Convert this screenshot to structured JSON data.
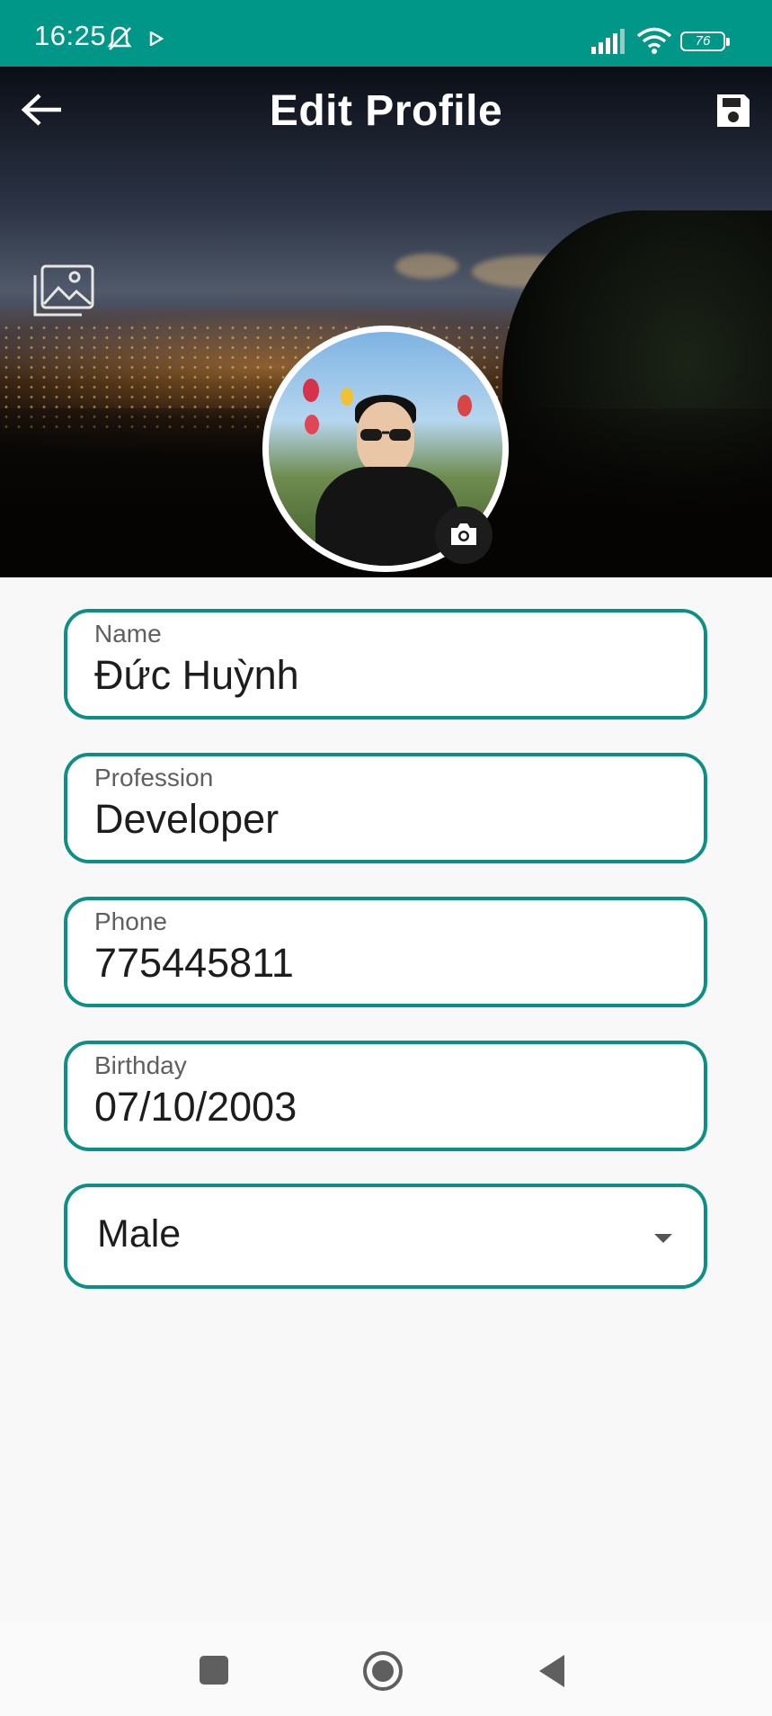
{
  "status_bar": {
    "time": "16:25",
    "battery": "76",
    "icons": [
      "bell-off-icon",
      "play-icon",
      "signal-icon",
      "wifi-icon",
      "battery-icon"
    ]
  },
  "header": {
    "title": "Edit Profile",
    "back_icon": "arrow-left-icon",
    "save_icon": "floppy-disk-icon"
  },
  "cover": {
    "change_cover_icon": "image-gallery-icon",
    "change_avatar_icon": "camera-icon"
  },
  "form": {
    "name": {
      "label": "Name",
      "value": "Đức Huỳnh"
    },
    "profession": {
      "label": "Profession",
      "value": "Developer"
    },
    "phone": {
      "label": "Phone",
      "value": "775445811"
    },
    "birthday": {
      "label": "Birthday",
      "value": "07/10/2003"
    },
    "gender": {
      "selected": "Male",
      "icon": "caret-down-icon"
    }
  },
  "nav_bar": {
    "icons": [
      "square-recents-icon",
      "circle-home-icon",
      "triangle-back-icon"
    ]
  },
  "colors": {
    "accent": "#009688",
    "field_border": "#0e8f86"
  }
}
